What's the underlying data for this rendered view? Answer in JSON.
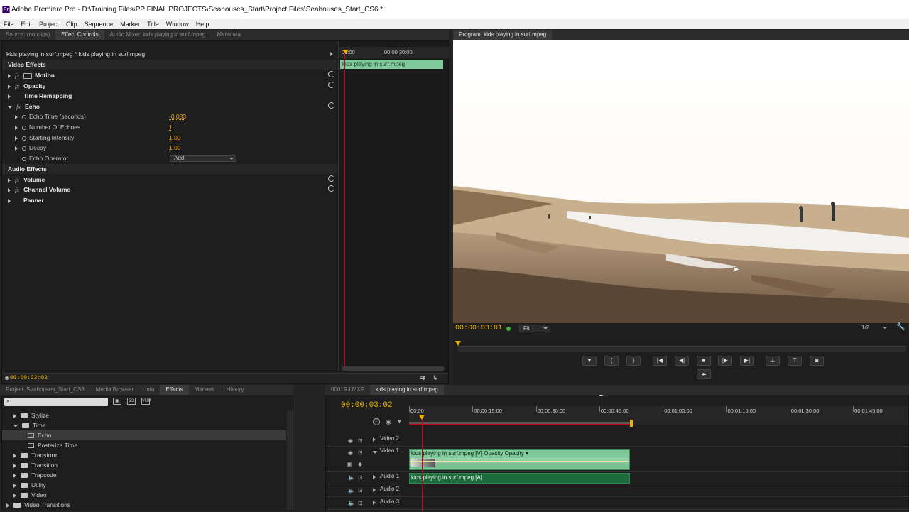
{
  "window": {
    "title": "Adobe Premiere Pro - D:\\Training Files\\PP FINAL PROJECTS\\Seahouses_Start\\Project Files\\Seahouses_Start_CS6 *"
  },
  "menu": [
    "File",
    "Edit",
    "Project",
    "Clip",
    "Sequence",
    "Marker",
    "Title",
    "Window",
    "Help"
  ],
  "source_panel": {
    "tabs": [
      "Source: (no clips)",
      "Effect Controls",
      "Audio Mixer: kids playing in surf.mpeg",
      "Metadata"
    ],
    "active_tab": "Effect Controls",
    "clip_path": "kids playing in surf.mpeg * kids playing in surf.mpeg",
    "timecode_start": "00:00",
    "timecode_mid": "00:00:30:00",
    "clip_bar_label": "kids playing in surf.mpeg",
    "video_effects_header": "Video Effects",
    "effects": [
      {
        "name": "Motion",
        "fx": "fx"
      },
      {
        "name": "Opacity",
        "fx": "fx"
      },
      {
        "name": "Time Remapping",
        "fx": ""
      },
      {
        "name": "Echo",
        "fx": "fx"
      }
    ],
    "echo_params": [
      {
        "name": "Echo Time (seconds)",
        "value": "-0.033"
      },
      {
        "name": "Number Of Echoes",
        "value": "1"
      },
      {
        "name": "Starting Intensity",
        "value": "1.00"
      },
      {
        "name": "Decay",
        "value": "1.00"
      },
      {
        "name": "Echo Operator",
        "value": "Add"
      }
    ],
    "audio_effects_header": "Audio Effects",
    "audio_effects": [
      {
        "name": "Volume",
        "fx": "fx"
      },
      {
        "name": "Channel Volume",
        "fx": "fx"
      },
      {
        "name": "Panner",
        "fx": ""
      }
    ],
    "footer_timecode": "00:00:03:02"
  },
  "program_panel": {
    "tab": "Program: kids playing in surf.mpeg",
    "timecode": "00:00:03:01",
    "fit": "Fit",
    "resolution": "1/2"
  },
  "project_panel": {
    "tabs": [
      "Project: Seahouses_Start_CS6",
      "Media Browser",
      "Info",
      "Effects",
      "Markers",
      "History"
    ],
    "active_tab": "Effects",
    "tree": [
      {
        "label": "Stylize",
        "indent": 1,
        "type": "folder",
        "open": false
      },
      {
        "label": "Time",
        "indent": 1,
        "type": "folder",
        "open": true
      },
      {
        "label": "Echo",
        "indent": 2,
        "type": "effect",
        "selected": true
      },
      {
        "label": "Posterize Time",
        "indent": 2,
        "type": "effect"
      },
      {
        "label": "Transform",
        "indent": 1,
        "type": "folder",
        "open": false
      },
      {
        "label": "Transition",
        "indent": 1,
        "type": "folder",
        "open": false
      },
      {
        "label": "Trapcode",
        "indent": 1,
        "type": "folder",
        "open": false
      },
      {
        "label": "Utility",
        "indent": 1,
        "type": "folder",
        "open": false
      },
      {
        "label": "Video",
        "indent": 1,
        "type": "folder",
        "open": false
      },
      {
        "label": "Video Transitions",
        "indent": 0,
        "type": "folder",
        "open": false
      }
    ]
  },
  "timeline": {
    "tabs": [
      "0001RJ.MXF",
      "kids playing in surf.mpeg"
    ],
    "active_tab": "kids playing in surf.mpeg",
    "timecode": "00:00:03:02",
    "ruler": [
      "00:00",
      "00:00:15:00",
      "00:00:30:00",
      "00:00:45:00",
      "00:01:00:00",
      "00:01:15:00",
      "00:01:30:00",
      "00:01:45:00"
    ],
    "tracks": [
      "Video 2",
      "Video 1",
      "Audio 1",
      "Audio 2",
      "Audio 3"
    ],
    "video_clip_label": "kids playing in surf.mpeg [V]  Opacity:Opacity ▾",
    "audio_clip_label": "kids playing in surf.mpeg [A]"
  },
  "colors": {
    "accent": "#f0b400",
    "clip_video": "#7fc99a",
    "clip_audio": "#1d6b3c",
    "playhead": "#c8001e"
  }
}
